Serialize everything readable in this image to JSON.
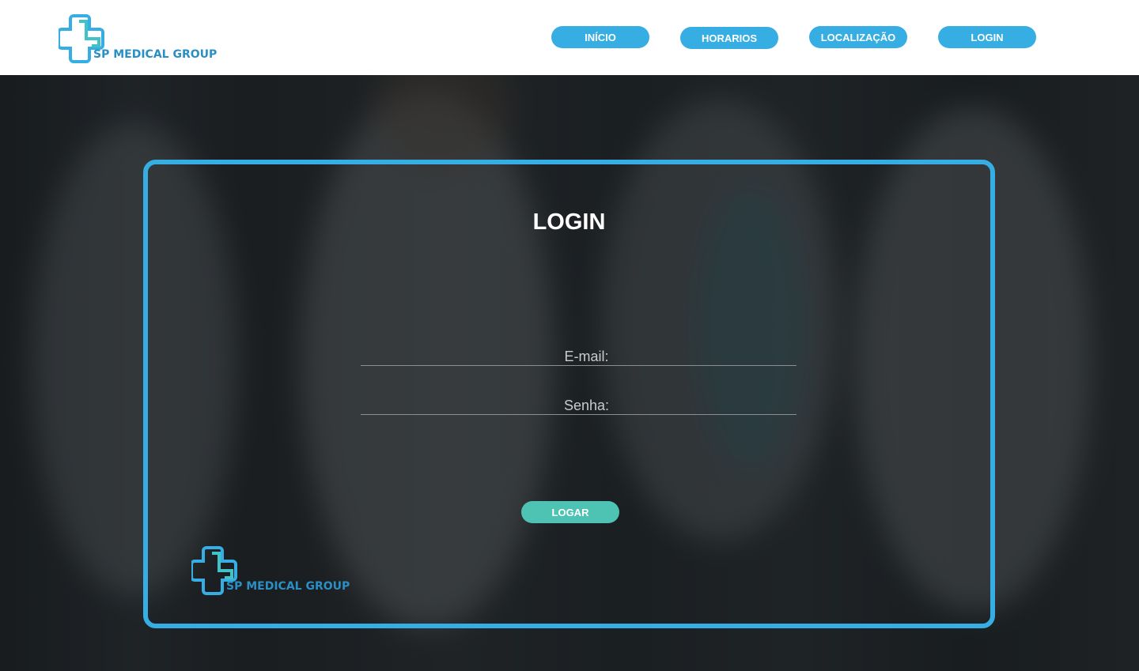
{
  "brand": {
    "name": "SP MEDICAL GROUP",
    "icon": "medical-cross-icon"
  },
  "nav": {
    "items": [
      {
        "label": "INÍCIO"
      },
      {
        "label": "HORARIOS"
      },
      {
        "label": "LOCALIZAÇÃO"
      },
      {
        "label": "LOGIN"
      }
    ]
  },
  "login": {
    "title": "LOGIN",
    "email_label": "E-mail:",
    "password_label": "Senha:",
    "submit_label": "LOGAR"
  },
  "colors": {
    "accent": "#36aee3",
    "submit": "#4fc3b3",
    "brand_text": "#2a8fc4",
    "logo_teal": "#40c2c9"
  }
}
